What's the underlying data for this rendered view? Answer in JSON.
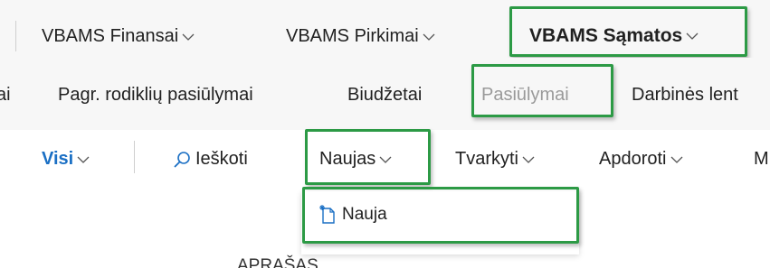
{
  "top_nav": {
    "items": [
      {
        "label": "VBAMS Finansai"
      },
      {
        "label": "VBAMS Pirkimai"
      },
      {
        "label": "VBAMS Sąmatos"
      }
    ]
  },
  "sub_nav": {
    "partial_label": "ai",
    "items": [
      {
        "label": "Pagr. rodiklių pasiūlymai"
      },
      {
        "label": "Biudžetai"
      },
      {
        "label": "Pasiūlymai"
      },
      {
        "label": "Darbinės lent"
      }
    ]
  },
  "action_bar": {
    "view_label": "Visi",
    "search_label": "Ieškoti",
    "new_label": "Naujas",
    "manage_label": "Tvarkyti",
    "process_label": "Apdoroti",
    "more_partial": "M"
  },
  "new_menu": {
    "items": [
      {
        "label": "Nauja"
      }
    ]
  },
  "below_text": "APRAŠAS",
  "colors": {
    "accent": "#2c9a45",
    "action_blue": "#1a6fc4",
    "muted": "#9a9a9a"
  }
}
